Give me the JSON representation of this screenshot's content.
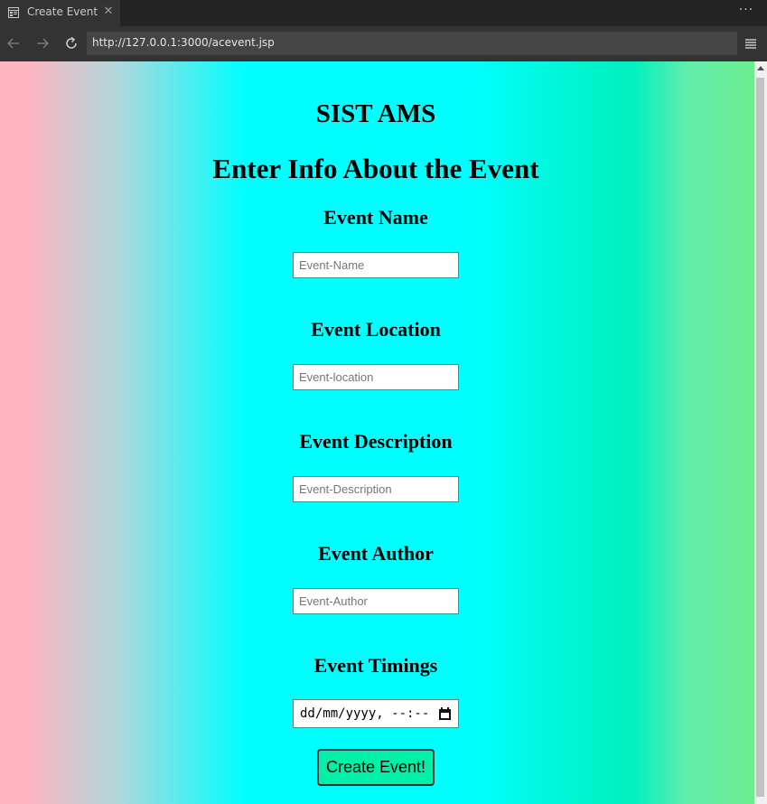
{
  "browser": {
    "tab_title": "Create Event",
    "url": "http://127.0.0.1:3000/acevent.jsp",
    "more_label": "···"
  },
  "page": {
    "site_title": "SIST AMS",
    "form_title": "Enter Info About the Event",
    "fields": [
      {
        "label": "Event Name",
        "placeholder": "Event-Name",
        "value": ""
      },
      {
        "label": "Event Location",
        "placeholder": "Event-location",
        "value": ""
      },
      {
        "label": "Event Description",
        "placeholder": "Event-Description",
        "value": ""
      },
      {
        "label": "Event Author",
        "placeholder": "Event-Author",
        "value": ""
      }
    ],
    "timings": {
      "label": "Event Timings",
      "value": "dd/mm/yyyy, --:-- --"
    },
    "submit_label": "Create Event!"
  },
  "colors": {
    "gradient": [
      "#ffb6c1",
      "#00ffff",
      "#00f0c0",
      "#6ded8f"
    ],
    "button_bg": "#00f0a8"
  },
  "icons": {
    "tab": "page-icon",
    "close": "close-icon",
    "back": "back-arrow-icon",
    "forward": "forward-arrow-icon",
    "reload": "reload-icon",
    "menu": "hamburger-menu-icon",
    "calendar": "calendar-icon"
  }
}
